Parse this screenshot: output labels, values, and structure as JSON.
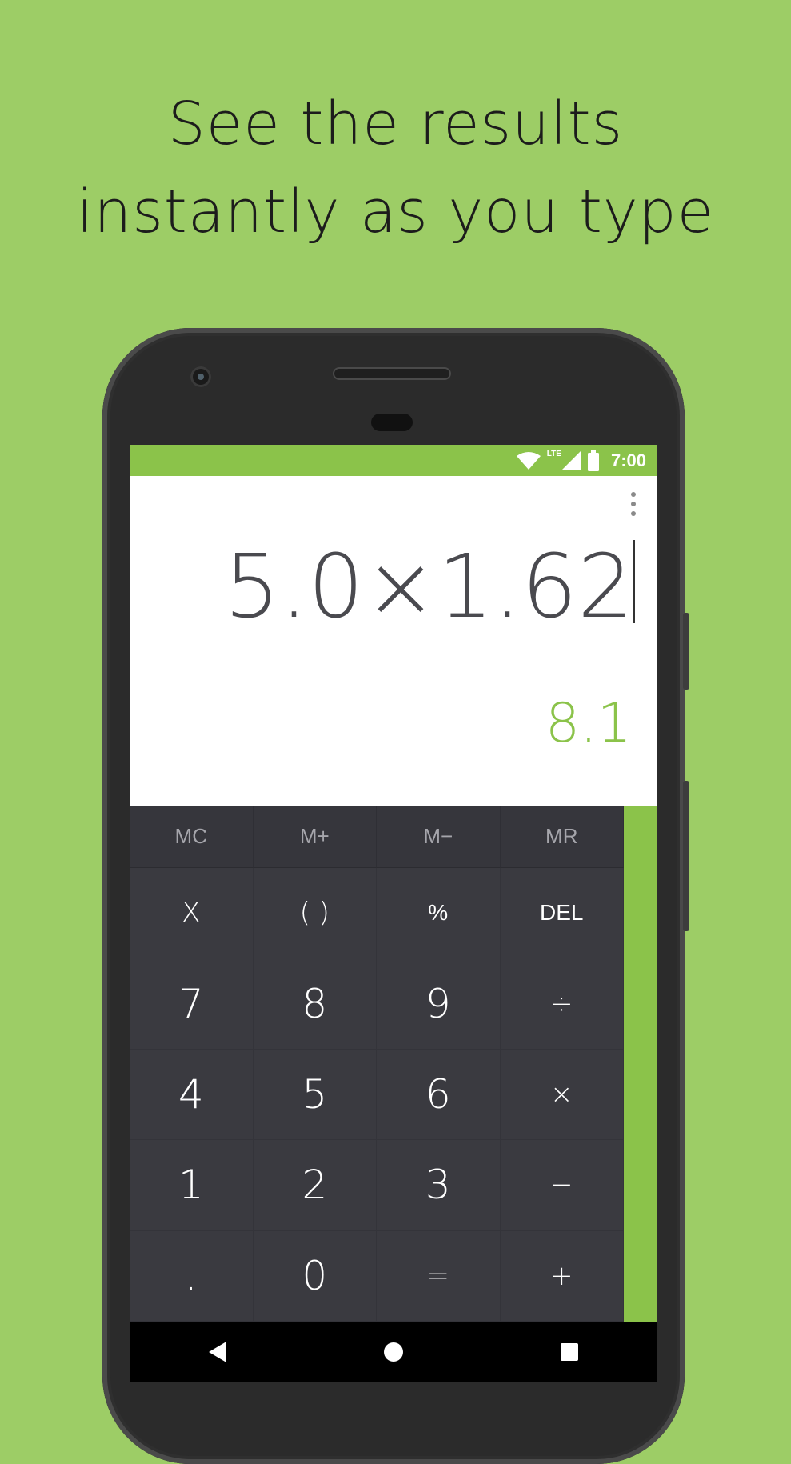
{
  "headline": {
    "line1": "See the results",
    "line2": "instantly as you type"
  },
  "status_bar": {
    "network": "LTE",
    "time": "7:00"
  },
  "display": {
    "expression": "5.0×1.62",
    "result": "8.1"
  },
  "memory_keys": [
    "MC",
    "M+",
    "M−",
    "MR"
  ],
  "keys": {
    "r1": [
      "X",
      "( )",
      "%",
      "DEL"
    ],
    "r2": [
      "7",
      "8",
      "9",
      "÷"
    ],
    "r3": [
      "4",
      "5",
      "6",
      "×"
    ],
    "r4": [
      "1",
      "2",
      "3",
      "−"
    ],
    "r5": [
      ".",
      "0",
      "=",
      "+"
    ]
  },
  "colors": {
    "background": "#9dcd66",
    "accent": "#8bc34a",
    "keypad": "#3a3a40"
  }
}
